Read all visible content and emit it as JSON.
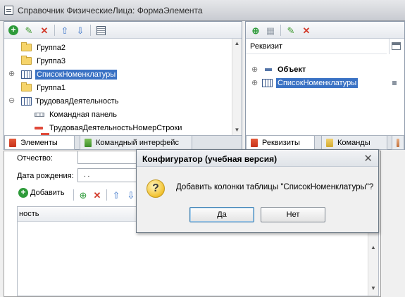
{
  "window": {
    "title": "Справочник ФизическиеЛица: ФормаЭлемента"
  },
  "elements_panel": {
    "tree": [
      {
        "label": "Группа2",
        "type": "folder"
      },
      {
        "label": "Группа3",
        "type": "folder"
      },
      {
        "label": "СписокНоменклатуры",
        "type": "table",
        "selected": true
      },
      {
        "label": "Группа1",
        "type": "folder"
      },
      {
        "label": "ТрудоваяДеятельность",
        "type": "table"
      },
      {
        "label": "Командная панель",
        "type": "command-panel"
      },
      {
        "label": "ТрудоваяДеятельностьНомерСтроки",
        "type": "field"
      }
    ],
    "tabs": [
      {
        "label": "Элементы",
        "active": true
      },
      {
        "label": "Командный интерфейс",
        "active": false
      }
    ]
  },
  "requisites_panel": {
    "column_header": "Реквизит",
    "tree": [
      {
        "label": "Объект"
      },
      {
        "label": "СписокНоменклатуры",
        "selected": true
      }
    ],
    "tabs": [
      {
        "label": "Реквизиты",
        "active": true
      },
      {
        "label": "Команды",
        "active": false
      }
    ]
  },
  "form_preview": {
    "patronymic_label": "Отчество:",
    "birthdate_label": "Дата рождения:",
    "birthdate_value": ". .",
    "add_button_label": "Добавить",
    "column_header": "ность"
  },
  "dialog": {
    "title": "Конфигуратор (учебная версия)",
    "message": "Добавить колонки таблицы \"СписокНоменклатуры\"?",
    "yes_label": "Да",
    "no_label": "Нет"
  },
  "colors": {
    "selection": "#3a72c4",
    "add_green": "#2e9b3a",
    "delete_red": "#d23a2a",
    "arrow_blue": "#3b74c8"
  }
}
